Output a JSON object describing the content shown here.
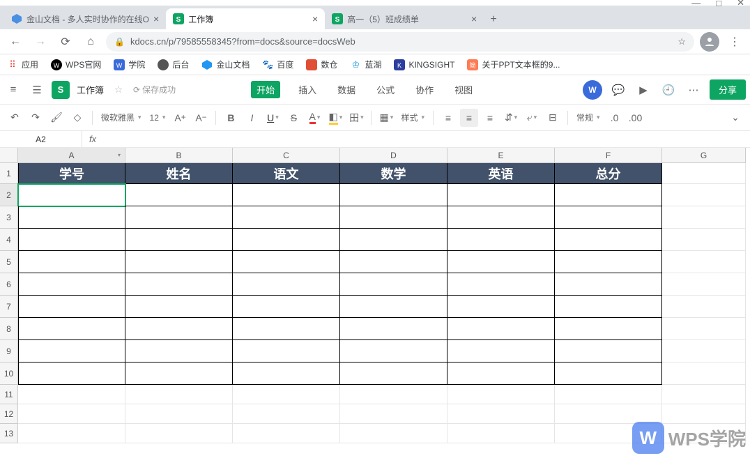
{
  "window": {
    "min": "—",
    "max": "□",
    "close": "✕"
  },
  "browserTabs": [
    {
      "title": "金山文档 - 多人实时协作的在线O",
      "icon": "blue"
    },
    {
      "title": "工作簿",
      "icon": "green"
    },
    {
      "title": "高一（5）班成绩单",
      "icon": "green"
    }
  ],
  "url": "kdocs.cn/p/79585558345?from=docs&source=docsWeb",
  "bookmarks": {
    "apps": "应用",
    "items": [
      {
        "label": "WPS官网",
        "color": "#000"
      },
      {
        "label": "学院",
        "color": "#3a6bdb"
      },
      {
        "label": "后台",
        "color": "#555"
      },
      {
        "label": "金山文档",
        "color": "#2196f3"
      },
      {
        "label": "百度",
        "color": "#2b66d9"
      },
      {
        "label": "数仓",
        "color": "#e04f35"
      },
      {
        "label": "蓝湖",
        "color": "#1296db"
      },
      {
        "label": "KINGSIGHT",
        "color": "#2c3e9e"
      },
      {
        "label": "关于PPT文本框的9...",
        "color": "#ff7b54"
      }
    ]
  },
  "app": {
    "logo": "S",
    "docname": "工作簿",
    "saveStatus": "保存成功",
    "menus": [
      "开始",
      "插入",
      "数据",
      "公式",
      "协作",
      "视图"
    ],
    "activeMenu": 0,
    "share": "分享"
  },
  "toolbar": {
    "fontName": "微软雅黑",
    "fontSize": "12",
    "styleLabel": "样式",
    "numFormat": "常规"
  },
  "nameBox": "A2",
  "fx": "fx",
  "columns": [
    "A",
    "B",
    "C",
    "D",
    "E",
    "F",
    "G"
  ],
  "headerRow": [
    "学号",
    "姓名",
    "语文",
    "数学",
    "英语",
    "总分"
  ],
  "rowNumbers": [
    "1",
    "2",
    "3",
    "4",
    "5",
    "6",
    "7",
    "8",
    "9",
    "10",
    "11",
    "12",
    "13"
  ],
  "watermark": "WPS学院"
}
